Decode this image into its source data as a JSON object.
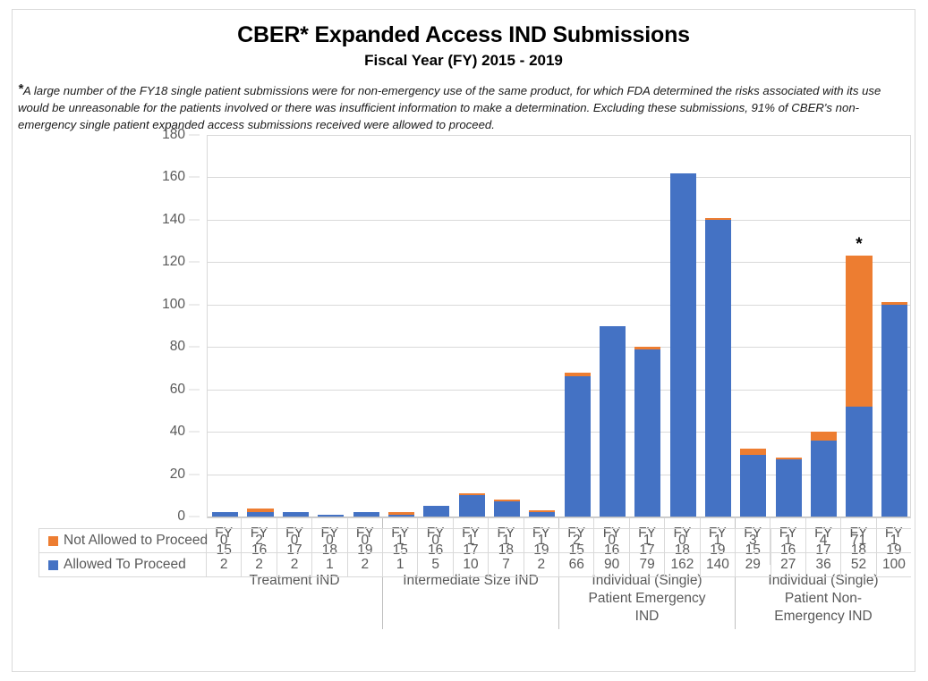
{
  "chart_data": {
    "type": "bar",
    "title": "CBER* Expanded Access IND Submissions",
    "subtitle": "Fiscal Year (FY) 2015 - 2019",
    "footnote": "A large number of the FY18 single patient submissions were for non-emergency use of the same product, for which FDA determined the risks associated with its use would be unreasonable for the patients involved or there was insufficient information to make a determination. Excluding these submissions, 91% of CBER's non-emergency single patient expanded access submissions received were allowed to proceed.",
    "footnote_marker": "*",
    "stacked": true,
    "xlabel": "",
    "ylabel": "",
    "ylim": [
      0,
      180
    ],
    "ytick_step": 20,
    "yticks": [
      0,
      20,
      40,
      60,
      80,
      100,
      120,
      140,
      160,
      180
    ],
    "grid": true,
    "legend_position": "data-table",
    "categories": [
      "FY 15",
      "FY 16",
      "FY 17",
      "FY 18",
      "FY 19",
      "FY 15",
      "FY 16",
      "FY 17",
      "FY 18",
      "FY 19",
      "FY 15",
      "FY 16",
      "FY 17",
      "FY 18",
      "FY 19",
      "FY 15",
      "FY 16",
      "FY 17",
      "FY 18",
      "FY 19"
    ],
    "category_lines": [
      [
        "FY",
        "15"
      ],
      [
        "FY",
        "16"
      ],
      [
        "FY",
        "17"
      ],
      [
        "FY",
        "18"
      ],
      [
        "FY",
        "19"
      ],
      [
        "FY",
        "15"
      ],
      [
        "FY",
        "16"
      ],
      [
        "FY",
        "17"
      ],
      [
        "FY",
        "18"
      ],
      [
        "FY",
        "19"
      ],
      [
        "FY",
        "15"
      ],
      [
        "FY",
        "16"
      ],
      [
        "FY",
        "17"
      ],
      [
        "FY",
        "18"
      ],
      [
        "FY",
        "19"
      ],
      [
        "FY",
        "15"
      ],
      [
        "FY",
        "16"
      ],
      [
        "FY",
        "17"
      ],
      [
        "FY",
        "18"
      ],
      [
        "FY",
        "19"
      ]
    ],
    "groups": [
      {
        "label": "Treatment IND",
        "size": 5
      },
      {
        "label": "Intermediate Size IND",
        "size": 5
      },
      {
        "label": "Individual (Single) Patient Emergency IND",
        "size": 5
      },
      {
        "label": "Individual (Single) Patient Non-Emergency IND",
        "size": 5
      }
    ],
    "series": [
      {
        "name": "Allowed To Proceed",
        "color": "#4472C4",
        "values": [
          2,
          2,
          2,
          1,
          2,
          1,
          5,
          10,
          7,
          2,
          66,
          90,
          79,
          162,
          140,
          29,
          27,
          36,
          52,
          100
        ]
      },
      {
        "name": "Not Allowed to Proceed",
        "color": "#ED7D31",
        "values": [
          0,
          2,
          0,
          0,
          0,
          1,
          0,
          1,
          1,
          1,
          2,
          0,
          1,
          0,
          1,
          3,
          1,
          4,
          71,
          1
        ]
      }
    ],
    "annotations": [
      {
        "category_index": 18,
        "text": "*",
        "total": 123
      }
    ]
  },
  "table": {
    "rows": [
      {
        "label": "Not Allowed to Proceed",
        "swatch_color": "#ED7D31",
        "values": [
          "0",
          "2",
          "0",
          "0",
          "0",
          "1",
          "0",
          "1",
          "1",
          "1",
          "2",
          "0",
          "1",
          "0",
          "1",
          "3",
          "1",
          "4",
          "71",
          "1"
        ]
      },
      {
        "label": "Allowed To Proceed",
        "swatch_color": "#4472C4",
        "values": [
          "2",
          "2",
          "2",
          "1",
          "2",
          "1",
          "5",
          "10",
          "7",
          "2",
          "66",
          "90",
          "79",
          "162",
          "140",
          "29",
          "27",
          "36",
          "52",
          "100"
        ]
      }
    ]
  },
  "colors": {
    "allowed": "#4472C4",
    "not_allowed": "#ED7D31",
    "grid": "#D9D9D9",
    "text": "#595959",
    "title": "#000000"
  }
}
